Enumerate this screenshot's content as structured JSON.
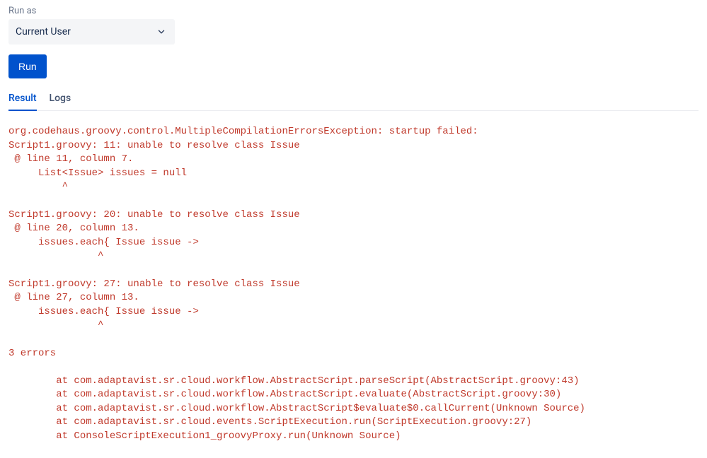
{
  "runAs": {
    "label": "Run as",
    "selected": "Current User"
  },
  "actions": {
    "run": "Run"
  },
  "tabs": {
    "result": "Result",
    "logs": "Logs"
  },
  "output": "org.codehaus.groovy.control.MultipleCompilationErrorsException: startup failed:\nScript1.groovy: 11: unable to resolve class Issue\n @ line 11, column 7.\n     List<Issue> issues = null\n         ^\n\nScript1.groovy: 20: unable to resolve class Issue\n @ line 20, column 13.\n     issues.each{ Issue issue ->\n               ^\n\nScript1.groovy: 27: unable to resolve class Issue\n @ line 27, column 13.\n     issues.each{ Issue issue ->\n               ^\n\n3 errors\n\n        at com.adaptavist.sr.cloud.workflow.AbstractScript.parseScript(AbstractScript.groovy:43)\n        at com.adaptavist.sr.cloud.workflow.AbstractScript.evaluate(AbstractScript.groovy:30)\n        at com.adaptavist.sr.cloud.workflow.AbstractScript$evaluate$0.callCurrent(Unknown Source)\n        at com.adaptavist.sr.cloud.events.ScriptExecution.run(ScriptExecution.groovy:27)\n        at ConsoleScriptExecution1_groovyProxy.run(Unknown Source)"
}
